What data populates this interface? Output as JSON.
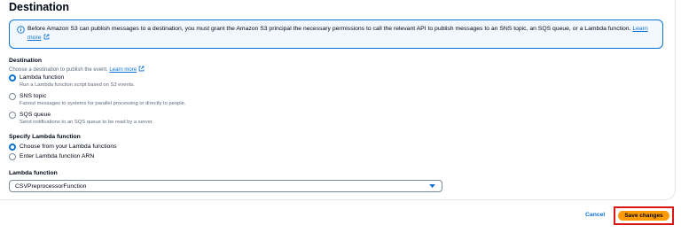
{
  "section": {
    "title": "Destination"
  },
  "alert": {
    "message": "Before Amazon S3 can publish messages to a destination, you must grant the Amazon S3 principal the necessary permissions to call the relevant API to publish messages to an SNS topic, an SQS queue, or a Lambda function.",
    "link_part1": "Learn",
    "link_part2": "more"
  },
  "destination": {
    "label": "Destination",
    "description": "Choose a destination to publish the event.",
    "learn_more": "Learn more",
    "options": [
      {
        "label": "Lambda function",
        "description": "Run a Lambda function script based on S3 events.",
        "checked": true
      },
      {
        "label": "SNS topic",
        "description": "Fanout messages to systems for parallel processing or directly to people.",
        "checked": false
      },
      {
        "label": "SQS queue",
        "description": "Send notifications to an SQS queue to be read by a server.",
        "checked": false
      }
    ]
  },
  "specify": {
    "label": "Specify Lambda function",
    "options": [
      {
        "label": "Choose from your Lambda functions",
        "checked": true
      },
      {
        "label": "Enter Lambda function ARN",
        "checked": false
      }
    ]
  },
  "lambda_select": {
    "label": "Lambda function",
    "value": "CSVPreprocessorFunction"
  },
  "footer": {
    "cancel_label": "Cancel",
    "save_label": "Save changes"
  },
  "colors": {
    "accent": "#0972d3",
    "primary_button": "#ff9900",
    "highlight_border": "#d91515"
  }
}
